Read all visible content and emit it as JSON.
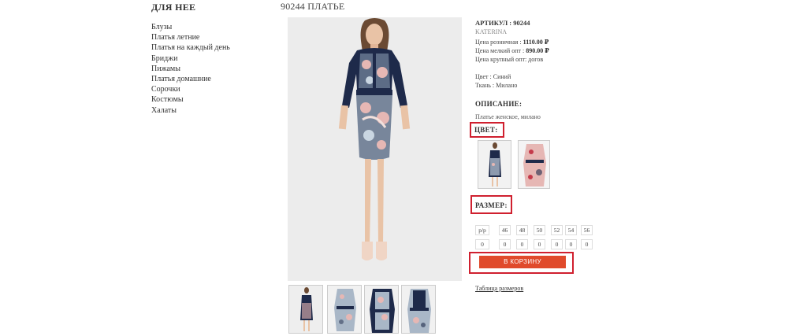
{
  "sidebar": {
    "title": "ДЛЯ НЕЕ",
    "items": [
      "Блузы",
      "Платья летние",
      "Платья на каждый день",
      "Бриджи",
      "Пижамы",
      "Платья домашние",
      "Сорочки",
      "Костюмы",
      "Халаты"
    ]
  },
  "product": {
    "title": "90244 ПЛАТЬЕ",
    "article": "АРТИКУЛ : 90244",
    "brand": "KATERINA",
    "price_retail_label": "Цена розничная :",
    "price_retail": "1110.00 ₽",
    "price_small_label": "Цена мелкий опт :",
    "price_small": "890.00 ₽",
    "price_large": "Цена крупный опт: догов",
    "color": "Цвет : Синий",
    "fabric": "Ткань : Милано",
    "description_label": "ОПИСАНИЕ:",
    "description": "Платье женское, милано"
  },
  "color_section": {
    "label": "ЦВЕТ:"
  },
  "size_section": {
    "label": "РАЗМЕР:",
    "headers": [
      "р/р",
      "46",
      "48",
      "50",
      "52",
      "54",
      "56"
    ],
    "quantities": [
      "0",
      "0",
      "0",
      "0",
      "0",
      "0",
      "0"
    ]
  },
  "cart_button": "В КОРЗИНУ",
  "size_table_link": "Таблица размеров",
  "colors": {
    "highlight": "#d0202f",
    "button": "#e04a2b",
    "dress_navy": "#1e2a4a",
    "dress_pink": "#e6b7b4"
  },
  "icons": {
    "dress_photo": "dress-photo",
    "swatch_blue": "dress-swatch-blue",
    "swatch_pink": "dress-swatch-pink"
  }
}
